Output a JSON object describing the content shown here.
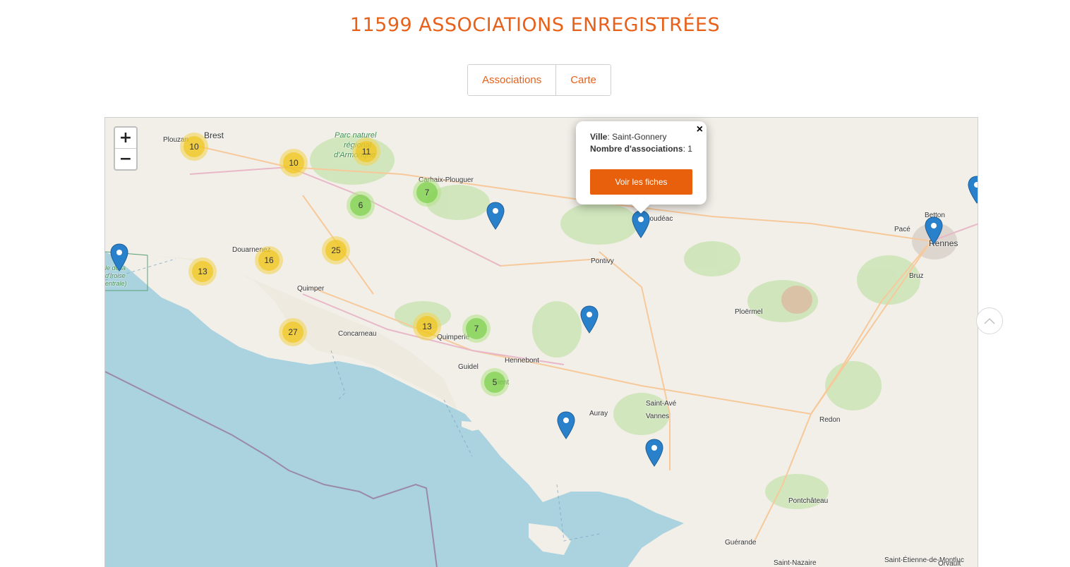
{
  "header": {
    "title": "11599 ASSOCIATIONS ENREGISTRÉES"
  },
  "view_toggle": {
    "associations_label": "Associations",
    "map_label": "Carte"
  },
  "map": {
    "zoom_in_label": "+",
    "zoom_out_label": "−",
    "place_labels": {
      "brest": "Brest",
      "plouzane": "Plouzan",
      "carhaix": "Carhaix-Plouguer",
      "douarnenez": "Douarnenez",
      "quimper": "Quimper",
      "concarneau": "Concarneau",
      "quimperle": "Quimperlé",
      "guidel": "Guidel",
      "hennebont": "Hennebont",
      "lorient": "ient",
      "pontivy": "Pontivy",
      "loudeac": "Loudéac",
      "ploermel": "Ploërmel",
      "auray": "Auray",
      "vannes": "Vannes",
      "saint_ave": "Saint-Avé",
      "redon": "Redon",
      "rennes": "Rennes",
      "pace": "Pacé",
      "betton": "Betton",
      "bruz": "Bruz",
      "pontchateau": "Pontchâteau",
      "guerande": "Guérande",
      "saint_nazaire": "Saint-Nazaire",
      "saint_etienne": "Saint-Étienne-de-Montluc",
      "orvault": "Orvault",
      "park_line1": "Parc naturel",
      "park_line2": "régional",
      "park_line3": "d'Armorique",
      "iroise_line1": "le de la",
      "iroise_line2": "d'Iroise",
      "iroise_line3": "entrale)"
    },
    "clusters": [
      {
        "id": "plouzane",
        "count": "10",
        "color": "yellow"
      },
      {
        "id": "landerneau",
        "count": "10",
        "color": "yellow"
      },
      {
        "id": "armorique",
        "count": "11",
        "color": "yellow"
      },
      {
        "id": "carhaix",
        "count": "7",
        "color": "green"
      },
      {
        "id": "chateauneuf",
        "count": "6",
        "color": "green"
      },
      {
        "id": "chateaulin",
        "count": "25",
        "color": "yellow"
      },
      {
        "id": "douarnenez",
        "count": "16",
        "color": "yellow"
      },
      {
        "id": "audierne",
        "count": "13",
        "color": "yellow"
      },
      {
        "id": "pont-labbe",
        "count": "27",
        "color": "yellow"
      },
      {
        "id": "quimperle",
        "count": "13",
        "color": "yellow"
      },
      {
        "id": "lanester",
        "count": "7",
        "color": "green"
      },
      {
        "id": "lorient",
        "count": "5",
        "color": "green"
      }
    ],
    "popup": {
      "city_label": "Ville",
      "city_value": "Saint-Gonnery",
      "count_label": "Nombre d'associations",
      "count_value": "1",
      "button_label": "Voir les fiches",
      "close_label": "×"
    }
  },
  "colors": {
    "accent": "#e8611a",
    "button": "#e8600c",
    "marker": "#2a81cb",
    "sea": "#aad3df",
    "land": "#f2efe9"
  }
}
